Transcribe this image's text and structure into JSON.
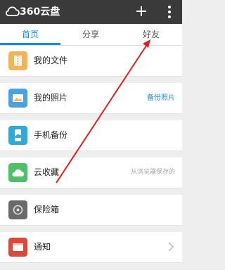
{
  "header": {
    "title": "360云盘"
  },
  "tabs": [
    {
      "label": "首页"
    },
    {
      "label": "分享"
    },
    {
      "label": "好友"
    }
  ],
  "items": [
    {
      "label": "我的文件",
      "right": "",
      "icon": "folder-icon",
      "color": "#f0b45a"
    },
    {
      "label": "我的照片",
      "right": "备份照片",
      "icon": "photo-icon",
      "color": "#4aa3e0"
    },
    {
      "label": "手机备份",
      "right": "",
      "icon": "phone-backup-icon",
      "color": "#33a8d6"
    },
    {
      "label": "云收藏",
      "right": "从浏览器保存的",
      "icon": "cloud-icon",
      "color": "#4fbf6a"
    },
    {
      "label": "保险箱",
      "right": "",
      "icon": "safe-icon",
      "color": "#6a6a6a"
    },
    {
      "label": "通知",
      "right": "",
      "icon": "notify-icon",
      "color": "#d84a3a"
    }
  ],
  "colors": {
    "accent": "#1a8ad9",
    "topbar": "#3a3a3a",
    "annotation_arrow": "#e02020"
  }
}
